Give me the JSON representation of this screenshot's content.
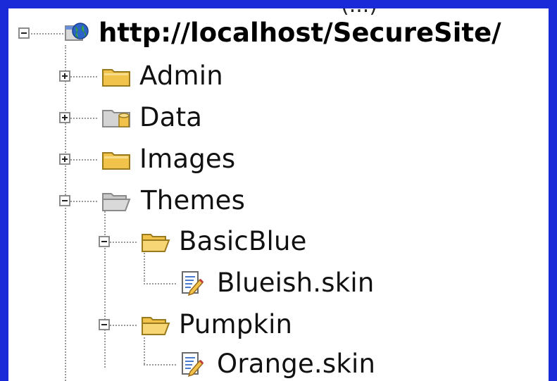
{
  "partial_header_text": "(...)",
  "tree": {
    "root": {
      "label": "http://localhost/SecureSite/",
      "icon": "globe-site-icon",
      "expanded": true
    },
    "items": [
      {
        "label": "Admin",
        "icon": "folder-icon",
        "expanded": false
      },
      {
        "label": "Data",
        "icon": "data-folder-icon",
        "expanded": false
      },
      {
        "label": "Images",
        "icon": "folder-icon",
        "expanded": false
      },
      {
        "label": "Themes",
        "icon": "open-folder-icon",
        "expanded": true
      },
      {
        "label": "BasicBlue",
        "icon": "open-folder-icon",
        "expanded": true
      },
      {
        "label": "Blueish.skin",
        "icon": "skin-file-icon"
      },
      {
        "label": "Pumpkin",
        "icon": "open-folder-icon",
        "expanded": true
      },
      {
        "label": "Orange.skin",
        "icon": "skin-file-icon"
      }
    ]
  },
  "colors": {
    "background_blue": "#1a2ad8",
    "panel": "#ffffff",
    "folder_yellow": "#f2c34a",
    "folder_grey": "#c8c8c8"
  }
}
